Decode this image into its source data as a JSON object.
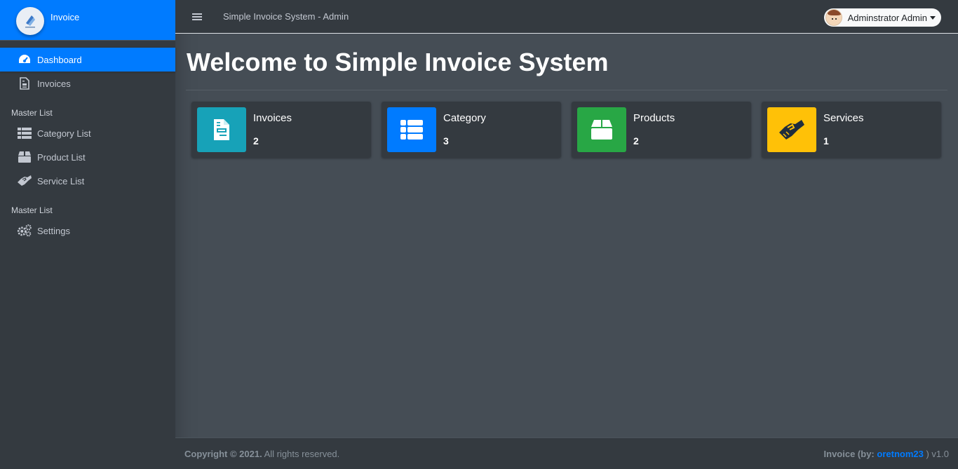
{
  "brand": {
    "name": "Invoice"
  },
  "sidebar": {
    "items": [
      {
        "label": "Dashboard",
        "icon": "tachometer-icon",
        "active": true
      },
      {
        "label": "Invoices",
        "icon": "file-invoice-icon"
      }
    ],
    "section1": {
      "header": "Master List",
      "items": [
        {
          "label": "Category List",
          "icon": "th-list-icon"
        },
        {
          "label": "Product List",
          "icon": "box-icon"
        },
        {
          "label": "Service List",
          "icon": "handshake-icon"
        }
      ]
    },
    "section2": {
      "header": "Master List",
      "items": [
        {
          "label": "Settings",
          "icon": "cogs-icon"
        }
      ]
    }
  },
  "topbar": {
    "title": "Simple Invoice System - Admin",
    "user": "Adminstrator Admin"
  },
  "main": {
    "title": "Welcome to Simple Invoice System",
    "cards": [
      {
        "label": "Invoices",
        "count": "2",
        "color": "#17a2b8",
        "icon": "file-invoice-icon"
      },
      {
        "label": "Category",
        "count": "3",
        "color": "#007bff",
        "icon": "th-list-icon"
      },
      {
        "label": "Products",
        "count": "2",
        "color": "#28a745",
        "icon": "box-icon"
      },
      {
        "label": "Services",
        "count": "1",
        "color": "#ffc107",
        "icon": "handshake-icon"
      }
    ]
  },
  "footer": {
    "copyright": "Copyright © 2021.",
    "rights": "All rights reserved.",
    "app_prefix": "Invoice (by:",
    "author": "oretnom23",
    "app_suffix": ") v1.0"
  },
  "colors": {
    "accent": "#007bff",
    "sidebar_bg": "#343a40",
    "content_bg": "#454d55"
  }
}
